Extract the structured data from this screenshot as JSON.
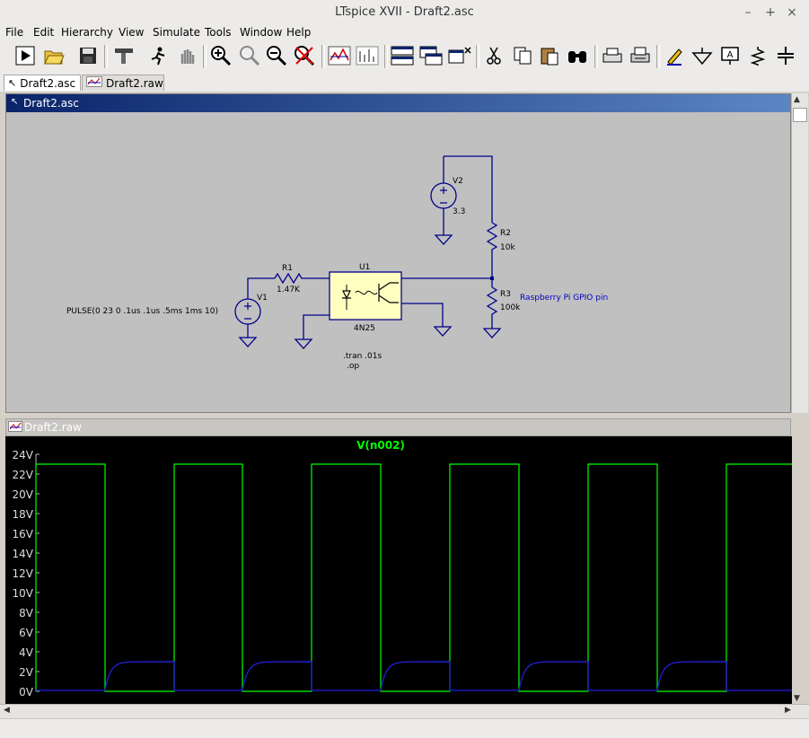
{
  "window": {
    "title": "LTspice XVII - Draft2.asc"
  },
  "window_controls": [
    "–",
    "+",
    "×"
  ],
  "menu": [
    "File",
    "Edit",
    "Hierarchy",
    "View",
    "Simulate",
    "Tools",
    "Window",
    "Help"
  ],
  "toolbar_icons": [
    "run-icon",
    "open-icon",
    "save-icon",
    "control-panel-icon",
    "halt-icon",
    "pan-hand-icon",
    "zoom-in-icon",
    "zoom-area-icon",
    "zoom-out-icon",
    "zoom-cancel-icon",
    "autorange-icon",
    "fft-icon",
    "tile-windows-icon",
    "cascade-windows-icon",
    "close-windows-icon",
    "cut-icon",
    "copy-icon",
    "paste-icon",
    "find-icon",
    "print-preview-icon",
    "print-icon",
    "pencil-icon",
    "ground-icon",
    "label-net-icon",
    "resistor-icon",
    "capacitor-icon"
  ],
  "tabs": [
    {
      "label": "Draft2.asc",
      "active": true
    },
    {
      "label": "Draft2.raw",
      "active": false
    }
  ],
  "schematic": {
    "window_title": "Draft2.asc",
    "labels": {
      "v2_name": "V2",
      "v2_value": "3.3",
      "r2_name": "R2",
      "r2_value": "10k",
      "r1_name": "R1",
      "r1_value": "1.47K",
      "u1_name": "U1",
      "u1_value": "4N25",
      "r3_name": "R3",
      "r3_value": "100k",
      "v1_name": "V1",
      "v1_pulse": "PULSE(0 23 0 .1us .1us .5ms 1ms 10)",
      "net_label": "Raspberry Pi GPIO pin",
      "directive1": ".tran .01s",
      "directive2": ".op"
    }
  },
  "waveform_window": {
    "title": "Draft2.raw"
  },
  "chart_data": {
    "type": "line",
    "title": "V(n002)",
    "xlabel": "",
    "ylabel": "",
    "ylim": [
      0,
      24
    ],
    "yticks": [
      "24V",
      "22V",
      "20V",
      "18V",
      "16V",
      "14V",
      "12V",
      "10V",
      "8V",
      "6V",
      "4V",
      "2V",
      "0V"
    ],
    "grid": false,
    "series": [
      {
        "name": "V(n002)",
        "color": "#00ff00",
        "x": [
          "0.0",
          "0.0",
          "0.5",
          "0.5",
          "1.0",
          "1.0",
          "1.5",
          "1.5",
          "2.0",
          "2.0",
          "2.5",
          "2.5",
          "3.0",
          "3.0",
          "3.5",
          "3.5",
          "4.0",
          "4.0",
          "4.5",
          "4.5",
          "5.0",
          "5.0",
          "5.5"
        ],
        "values": [
          0,
          23,
          23,
          0,
          0,
          23,
          23,
          0,
          0,
          23,
          23,
          0,
          0,
          23,
          23,
          0,
          0,
          23,
          23,
          0,
          0,
          23,
          23
        ]
      },
      {
        "color": "#1e1ecc",
        "values": [
          0.1,
          0.1,
          3.0,
          3.0,
          0.1,
          0.1,
          3.0,
          3.0,
          0.1,
          0.1,
          3.0,
          3.0,
          0.1,
          0.1,
          3.0,
          3.0,
          0.1,
          0.1,
          3.0,
          3.0,
          0.1,
          0.1
        ]
      }
    ]
  }
}
